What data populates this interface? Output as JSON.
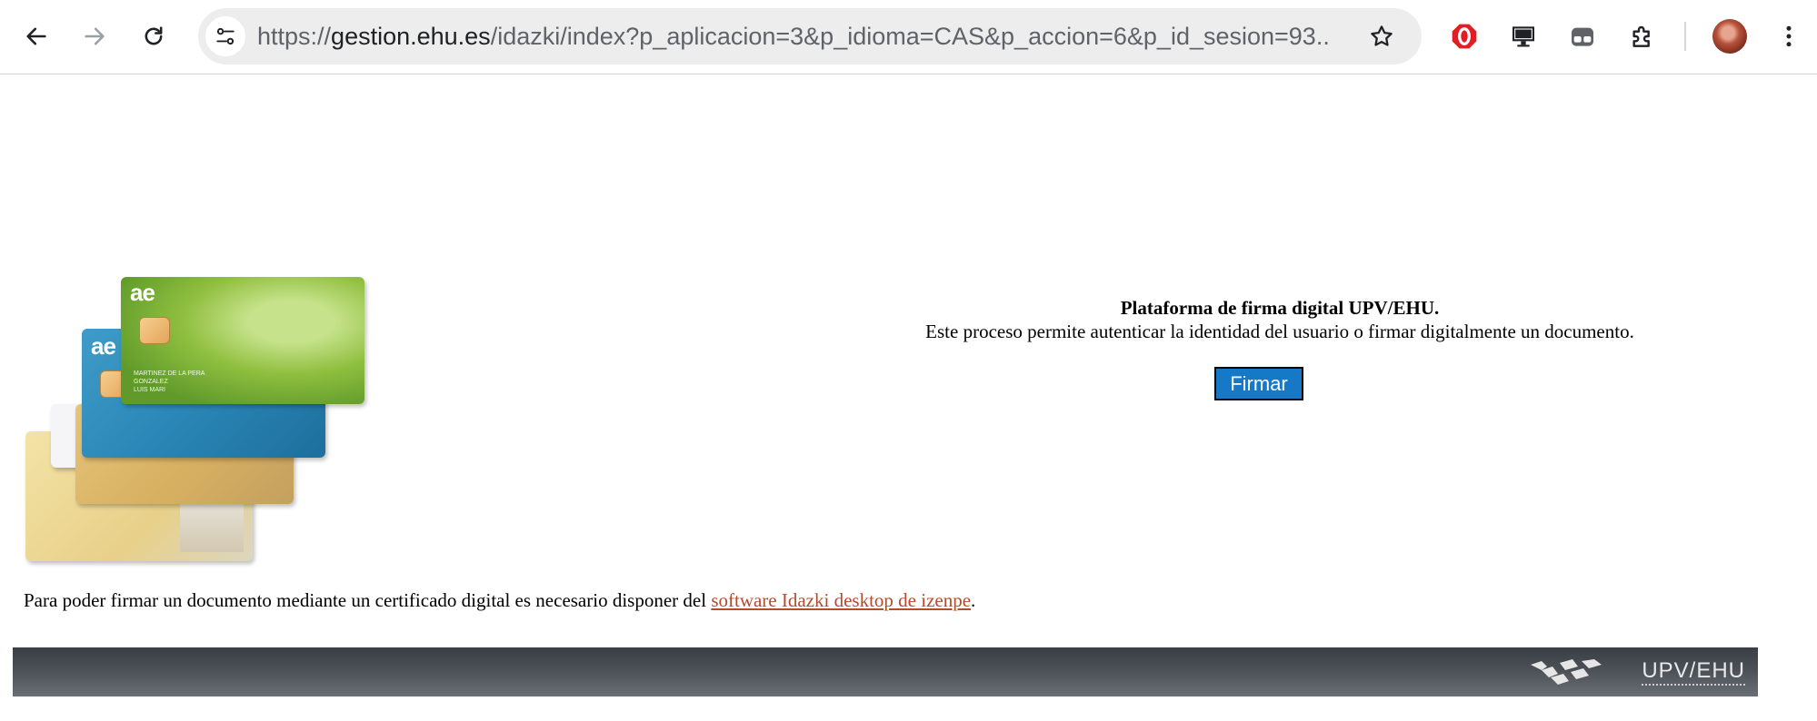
{
  "browser": {
    "url_prefix": "https://",
    "url_host": "gestion.ehu.es",
    "url_path": "/idazki/index?p_aplicacion=3&p_idioma=CAS&p_accion=6&p_id_sesion=93...",
    "icons": {
      "back": "arrow-left-icon",
      "forward": "arrow-right-icon",
      "reload": "reload-icon",
      "site_info": "tune-icon",
      "bookmark": "star-icon",
      "opera": "opera-icon",
      "cast": "monitor-icon",
      "incognito": "glasses-icon",
      "extensions": "puzzle-icon",
      "menu": "kebab-menu-icon"
    },
    "colors": {
      "omnibox_bg": "#ededed",
      "opera_red": "#e21d23"
    }
  },
  "page": {
    "title": "Plataforma de firma digital UPV/EHU.",
    "description": "Este proceso permite autenticar la identidad del usuario o firmar digitalmente un documento.",
    "sign_button": "Firmar",
    "footnote_prefix": "Para poder firmar un documento mediante un certificado digital es necesario disponer del ",
    "footnote_link": "software Idazki desktop de izenpe",
    "footnote_suffix": ".",
    "cards": {
      "logo": "ae",
      "holder_lines": [
        "MARTINEZ DE LA PERA",
        "GONZALEZ",
        "LUIS MARI"
      ]
    },
    "colors": {
      "button_bg": "#1679c8",
      "link": "#b44b2b",
      "footer_bg": "#4b5057"
    }
  },
  "footer": {
    "brand": "UPV/EHU"
  }
}
